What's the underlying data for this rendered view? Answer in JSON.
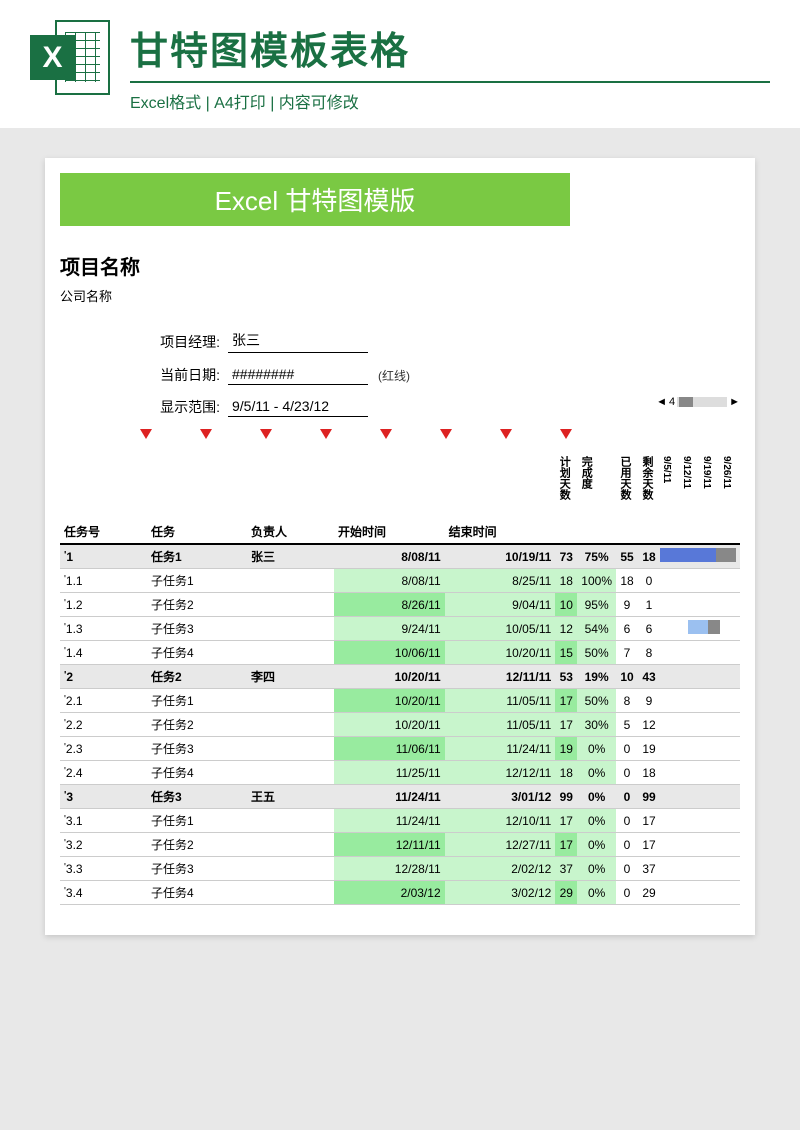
{
  "header": {
    "title": "甘特图模板表格",
    "subtitle": "Excel格式 | A4打印 | 内容可修改",
    "icon_letter": "X"
  },
  "banner": "Excel 甘特图模版",
  "project": {
    "name_label": "项目名称",
    "company_label": "公司名称"
  },
  "meta": {
    "manager_label": "项目经理:",
    "manager_value": "张三",
    "date_label": "当前日期:",
    "date_value": "########",
    "date_note": "(红线)",
    "range_label": "显示范围:",
    "range_value": "9/5/11 - 4/23/12"
  },
  "scroll": {
    "left": "◄",
    "num": "4",
    "right": "►"
  },
  "columns": {
    "task_no": "任务号",
    "task": "任务",
    "owner": "负责人",
    "start": "开始时间",
    "end": "结束时间",
    "plan_days": "计划天数",
    "progress": "完成度",
    "used_days": "已用天数",
    "remain_days": "剩余天数",
    "dates": [
      "9/5/11",
      "9/12/11",
      "9/19/11",
      "9/26/11"
    ]
  },
  "rows": [
    {
      "tick": "1",
      "no": "1",
      "task": "任务1",
      "owner": "张三",
      "start": "8/08/11",
      "end": "10/19/11",
      "plan": "73",
      "prog": "75%",
      "used": "55",
      "remain": "18",
      "main": true,
      "bar": "blue"
    },
    {
      "tick": "1",
      "no": "1.1",
      "task": "子任务1",
      "owner": "",
      "start": "8/08/11",
      "end": "8/25/11",
      "plan": "18",
      "prog": "100%",
      "used": "18",
      "remain": "0",
      "main": false
    },
    {
      "tick": "1",
      "no": "1.2",
      "task": "子任务2",
      "owner": "",
      "start": "8/26/11",
      "end": "9/04/11",
      "plan": "10",
      "prog": "95%",
      "used": "9",
      "remain": "1",
      "main": false
    },
    {
      "tick": "1",
      "no": "1.3",
      "task": "子任务3",
      "owner": "",
      "start": "9/24/11",
      "end": "10/05/11",
      "plan": "12",
      "prog": "54%",
      "used": "6",
      "remain": "6",
      "main": false,
      "bar": "lightblue"
    },
    {
      "tick": "1",
      "no": "1.4",
      "task": "子任务4",
      "owner": "",
      "start": "10/06/11",
      "end": "10/20/11",
      "plan": "15",
      "prog": "50%",
      "used": "7",
      "remain": "8",
      "main": false
    },
    {
      "tick": "1",
      "no": "2",
      "task": "任务2",
      "owner": "李四",
      "start": "10/20/11",
      "end": "12/11/11",
      "plan": "53",
      "prog": "19%",
      "used": "10",
      "remain": "43",
      "main": true
    },
    {
      "tick": "1",
      "no": "2.1",
      "task": "子任务1",
      "owner": "",
      "start": "10/20/11",
      "end": "11/05/11",
      "plan": "17",
      "prog": "50%",
      "used": "8",
      "remain": "9",
      "main": false
    },
    {
      "tick": "1",
      "no": "2.2",
      "task": "子任务2",
      "owner": "",
      "start": "10/20/11",
      "end": "11/05/11",
      "plan": "17",
      "prog": "30%",
      "used": "5",
      "remain": "12",
      "main": false
    },
    {
      "tick": "1",
      "no": "2.3",
      "task": "子任务3",
      "owner": "",
      "start": "11/06/11",
      "end": "11/24/11",
      "plan": "19",
      "prog": "0%",
      "used": "0",
      "remain": "19",
      "main": false
    },
    {
      "tick": "1",
      "no": "2.4",
      "task": "子任务4",
      "owner": "",
      "start": "11/25/11",
      "end": "12/12/11",
      "plan": "18",
      "prog": "0%",
      "used": "0",
      "remain": "18",
      "main": false
    },
    {
      "tick": "1",
      "no": "3",
      "task": "任务3",
      "owner": "王五",
      "start": "11/24/11",
      "end": "3/01/12",
      "plan": "99",
      "prog": "0%",
      "used": "0",
      "remain": "99",
      "main": true
    },
    {
      "tick": "1",
      "no": "3.1",
      "task": "子任务1",
      "owner": "",
      "start": "11/24/11",
      "end": "12/10/11",
      "plan": "17",
      "prog": "0%",
      "used": "0",
      "remain": "17",
      "main": false
    },
    {
      "tick": "1",
      "no": "3.2",
      "task": "子任务2",
      "owner": "",
      "start": "12/11/11",
      "end": "12/27/11",
      "plan": "17",
      "prog": "0%",
      "used": "0",
      "remain": "17",
      "main": false
    },
    {
      "tick": "1",
      "no": "3.3",
      "task": "子任务3",
      "owner": "",
      "start": "12/28/11",
      "end": "2/02/12",
      "plan": "37",
      "prog": "0%",
      "used": "0",
      "remain": "37",
      "main": false
    },
    {
      "tick": "1",
      "no": "3.4",
      "task": "子任务4",
      "owner": "",
      "start": "2/03/12",
      "end": "3/02/12",
      "plan": "29",
      "prog": "0%",
      "used": "0",
      "remain": "29",
      "main": false
    }
  ]
}
